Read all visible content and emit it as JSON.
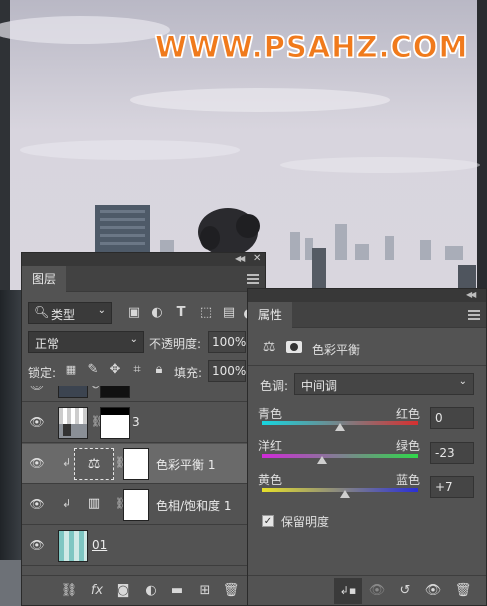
{
  "watermark": "WWW.PSAHZ.COM",
  "layers_panel": {
    "tab": "图层",
    "filter_kind": "类型",
    "blend_mode": "正常",
    "opacity_label": "不透明度:",
    "opacity_value": "100%",
    "lock_label": "锁定:",
    "fill_label": "填充:",
    "fill_value": "100%",
    "layers": [
      {
        "name": "",
        "selected": false,
        "icon": "layer-thumb-partial"
      },
      {
        "name": "3",
        "selected": false,
        "icon": "layer-thumb-city"
      },
      {
        "name": "色彩平衡  1",
        "selected": true,
        "icon": "balance-scale-icon"
      },
      {
        "name": "色相/饱和度  1",
        "selected": false,
        "icon": "hue-saturation-icon"
      },
      {
        "name": "01",
        "selected": false,
        "icon": "layer-thumb-teal"
      }
    ],
    "bottom_icons": [
      "link-icon",
      "fx-icon",
      "mask-icon",
      "adjustment-icon",
      "folder-icon",
      "new-layer-icon",
      "trash-icon"
    ]
  },
  "properties_panel": {
    "tab": "属性",
    "title": "色彩平衡",
    "tone_label": "色调:",
    "tone_value": "中间调",
    "sliders": [
      {
        "left": "青色",
        "right": "红色",
        "value": "0",
        "level": 0
      },
      {
        "left": "洋红",
        "right": "绿色",
        "value": "-23",
        "level": -23
      },
      {
        "left": "黄色",
        "right": "蓝色",
        "value": "+7",
        "level": 7
      }
    ],
    "preserve_label": "保留明度",
    "preserve_checked": true
  },
  "colors": {
    "panel_bg": "#535353",
    "selected_row": "#6a6a6a",
    "watermark": "#f07a1c"
  }
}
